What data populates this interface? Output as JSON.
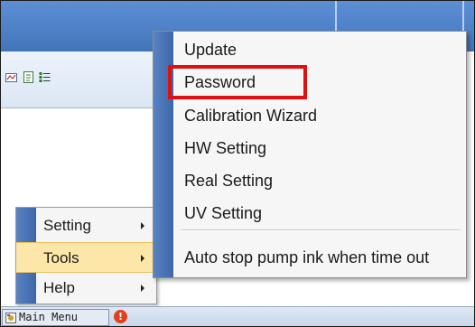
{
  "main_menu": {
    "items": [
      {
        "label": "Setting",
        "has_submenu": true
      },
      {
        "label": "Tools",
        "has_submenu": true,
        "highlighted": true
      },
      {
        "label": "Help",
        "has_submenu": true
      }
    ]
  },
  "tools_submenu": {
    "items": [
      {
        "label": "Update"
      },
      {
        "label": "Password",
        "annotated": true
      },
      {
        "label": "Calibration Wizard"
      },
      {
        "label": "HW Setting"
      },
      {
        "label": "Real Setting"
      },
      {
        "label": "UV Setting"
      },
      {
        "label": "Auto stop pump ink when time out"
      }
    ]
  },
  "statusbar": {
    "main_menu_label": "Main Menu"
  },
  "colors": {
    "title_blue": "#4d80c6",
    "menu_gutter": "#3d66a8",
    "hover_fill": "#fde7a8",
    "annotation_red": "#e01010",
    "alert_red": "#e0401c"
  },
  "icons": [
    "toolbar-chart-icon",
    "toolbar-document-icon",
    "toolbar-list-icon",
    "main-menu-icon",
    "alert-icon",
    "chevron-right-icon"
  ]
}
